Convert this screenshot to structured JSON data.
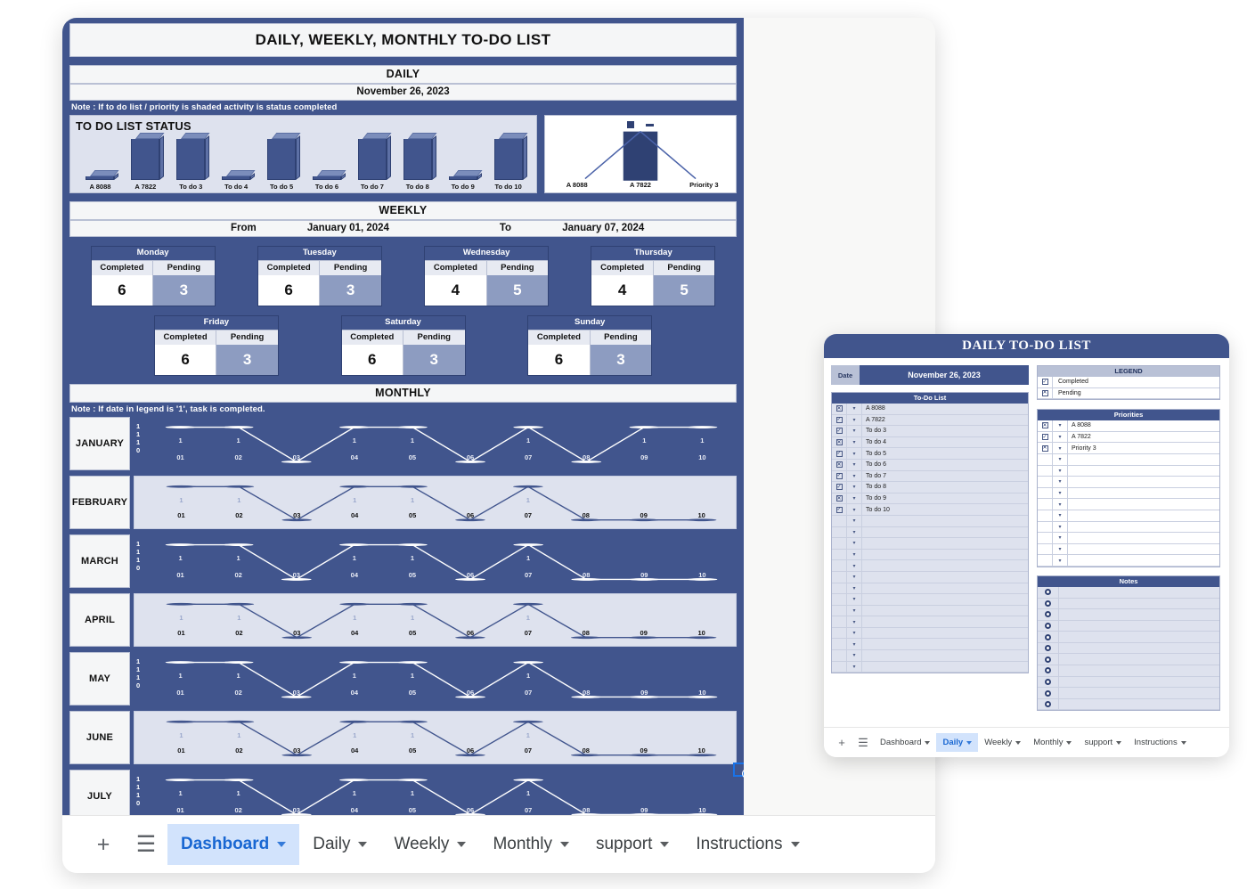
{
  "colors": {
    "brand_blue": "#41558d",
    "light_blue": "#dee2ee",
    "pending_blue": "#8d9cc1",
    "accent": "#1967d2",
    "tab_active_bg": "#d2e3fc"
  },
  "window1": {
    "title": "DAILY, WEEKLY, MONTHLY TO-DO LIST",
    "daily": {
      "section_label": "DAILY",
      "date": "November 26, 2023",
      "note": "Note : If to do list  / priority is shaded activity is status completed",
      "status_title": "TO DO LIST STATUS"
    },
    "weekly": {
      "section_label": "WEEKLY",
      "from_label": "From",
      "from_date": "January 01, 2024",
      "to_label": "To",
      "to_date": "January 07, 2024",
      "col_completed": "Completed",
      "col_pending": "Pending",
      "days": [
        {
          "name": "Monday",
          "completed": "6",
          "pending": "3"
        },
        {
          "name": "Tuesday",
          "completed": "6",
          "pending": "3"
        },
        {
          "name": "Wednesday",
          "completed": "4",
          "pending": "5"
        },
        {
          "name": "Thursday",
          "completed": "4",
          "pending": "5"
        },
        {
          "name": "Friday",
          "completed": "6",
          "pending": "3"
        },
        {
          "name": "Saturday",
          "completed": "6",
          "pending": "3"
        },
        {
          "name": "Sunday",
          "completed": "6",
          "pending": "3"
        }
      ]
    },
    "monthly": {
      "section_label": "MONTHLY",
      "note": "Note : If date  in legend is '1',  task is completed."
    },
    "tabs": [
      {
        "label": "Dashboard",
        "active": true
      },
      {
        "label": "Daily",
        "active": false
      },
      {
        "label": "Weekly",
        "active": false
      },
      {
        "label": "Monthly",
        "active": false
      },
      {
        "label": "support",
        "active": false
      },
      {
        "label": "Instructions",
        "active": false
      }
    ],
    "tabbar_add_icon": "plus-icon",
    "tabbar_list_icon": "sheet-list-icon"
  },
  "window2": {
    "title": "DAILY TO-DO LIST",
    "date_label": "Date",
    "date_value": "November 26, 2023",
    "todo_header": "To-Do List",
    "legend_header": "LEGEND",
    "legend": [
      {
        "mark": "checked",
        "label": "Completed"
      },
      {
        "mark": "crossed",
        "label": "Pending"
      }
    ],
    "priorities_header": "Priorities",
    "notes_header": "Notes",
    "todo_items": [
      {
        "text": "A 8088",
        "mark": "crossed"
      },
      {
        "text": "A 7822",
        "mark": "checked"
      },
      {
        "text": "To do 3",
        "mark": "checked"
      },
      {
        "text": "To do 4",
        "mark": "crossed"
      },
      {
        "text": "To do 5",
        "mark": "checked"
      },
      {
        "text": "To do 6",
        "mark": "crossed"
      },
      {
        "text": "To do 7",
        "mark": "checked"
      },
      {
        "text": "To do 8",
        "mark": "checked"
      },
      {
        "text": "To do 9",
        "mark": "crossed"
      },
      {
        "text": "To do 10",
        "mark": "checked"
      }
    ],
    "todo_empty_rows": 14,
    "priority_items": [
      {
        "text": "A 8088",
        "mark": "crossed"
      },
      {
        "text": "A 7822",
        "mark": "checked"
      },
      {
        "text": "Priority 3",
        "mark": "crossed"
      }
    ],
    "priority_empty_rows": 10,
    "notes_rows": 11,
    "tabs": [
      {
        "label": "Dashboard",
        "active": false
      },
      {
        "label": "Daily",
        "active": true
      },
      {
        "label": "Weekly",
        "active": false
      },
      {
        "label": "Monthly",
        "active": false
      },
      {
        "label": "support",
        "active": false
      },
      {
        "label": "Instructions",
        "active": false
      }
    ]
  },
  "chart_data": [
    {
      "type": "bar",
      "title": "TO DO LIST STATUS",
      "categories": [
        "A 8088",
        "A 7822",
        "To do 3",
        "To do 4",
        "To do 5",
        "To do 6",
        "To do 7",
        "To do 8",
        "To do 9",
        "To do 10"
      ],
      "values": [
        0,
        1,
        1,
        0,
        1,
        0,
        1,
        1,
        0,
        1
      ],
      "ylim": [
        0,
        1
      ],
      "xlabel": "",
      "ylabel": "",
      "grid": false,
      "legend": "none",
      "note": "3-D column chart; 1 = pending/shown tall, 0 = completed/flat"
    },
    {
      "type": "pie",
      "title": "",
      "categories": [
        "A 8088",
        "A 7822",
        "Priority 3"
      ],
      "values": [
        0,
        1,
        0
      ],
      "legend": "top",
      "note": "Priority distribution; only A 7822 has a value"
    },
    {
      "type": "line",
      "title": "MONTHLY",
      "x": [
        "01",
        "02",
        "03",
        "04",
        "05",
        "06",
        "07",
        "08",
        "09",
        "10"
      ],
      "ylim": [
        0,
        1
      ],
      "yticks": [
        "1",
        "1",
        "1",
        "0"
      ],
      "xlabel": "",
      "ylabel": "",
      "grid": false,
      "legend": "none",
      "series": [
        {
          "name": "JANUARY",
          "values": [
            1,
            1,
            0,
            1,
            1,
            0,
            1,
            0,
            1,
            1
          ]
        },
        {
          "name": "FEBRUARY",
          "values": [
            1,
            1,
            0,
            1,
            1,
            0,
            1,
            0,
            0,
            0
          ]
        },
        {
          "name": "MARCH",
          "values": [
            1,
            1,
            0,
            1,
            1,
            0,
            1,
            0,
            0,
            0
          ]
        },
        {
          "name": "APRIL",
          "values": [
            1,
            1,
            0,
            1,
            1,
            0,
            1,
            0,
            0,
            0
          ]
        },
        {
          "name": "MAY",
          "values": [
            1,
            1,
            0,
            1,
            1,
            0,
            1,
            0,
            0,
            0
          ]
        },
        {
          "name": "JUNE",
          "values": [
            1,
            1,
            0,
            1,
            1,
            0,
            1,
            0,
            0,
            0
          ]
        },
        {
          "name": "JULY",
          "values": [
            1,
            1,
            0,
            1,
            1,
            0,
            1,
            0,
            0,
            0
          ]
        }
      ]
    }
  ]
}
